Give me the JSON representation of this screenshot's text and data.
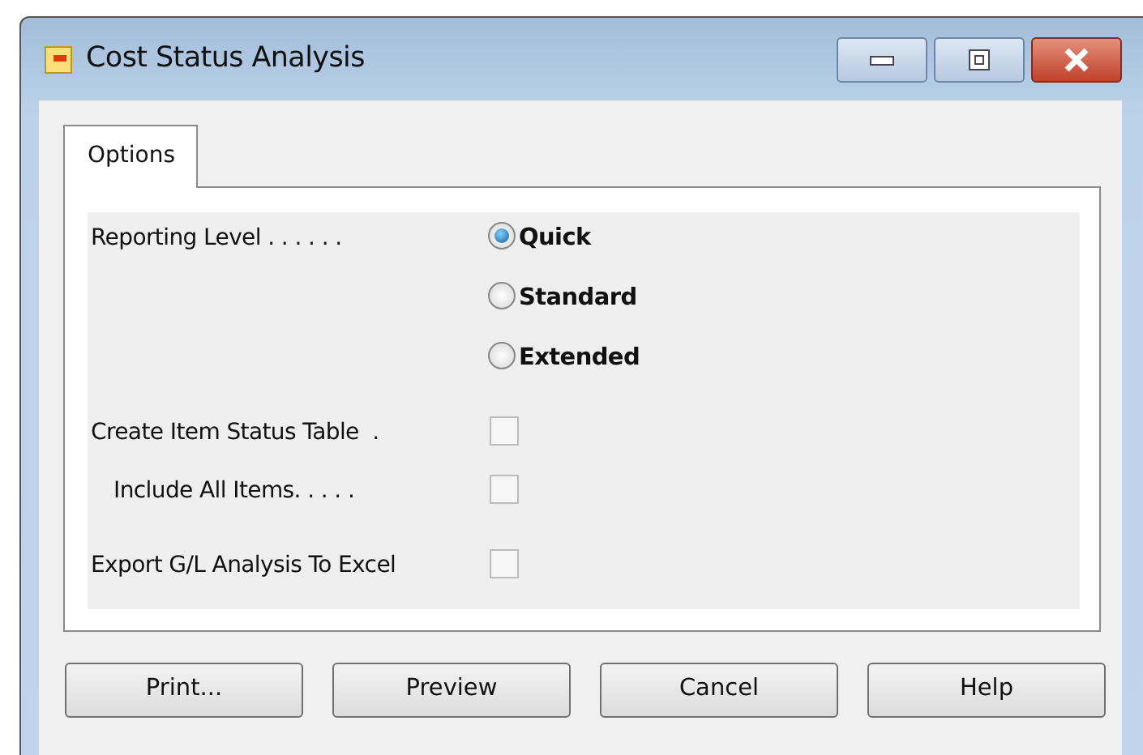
{
  "window": {
    "title": "Cost Status Analysis"
  },
  "tabs": [
    {
      "label": "Options",
      "selected": true
    }
  ],
  "options": [
    {
      "kind": "radio",
      "label": "Reporting Level . . . . . .",
      "indent": false,
      "choices": [
        {
          "label": "Quick",
          "selected": true
        },
        {
          "label": "Standard",
          "selected": false
        },
        {
          "label": "Extended",
          "selected": false
        }
      ]
    },
    {
      "kind": "checkbox",
      "label": "Create Item Status Table  .",
      "indent": false,
      "checked": false
    },
    {
      "kind": "checkbox",
      "label": "Include All Items. . . . .",
      "indent": true,
      "checked": false
    },
    {
      "kind": "checkbox",
      "label": "Export G/L Analysis To Excel",
      "indent": false,
      "checked": false
    }
  ],
  "buttons": [
    "Print...",
    "Preview",
    "Cancel",
    "Help"
  ]
}
